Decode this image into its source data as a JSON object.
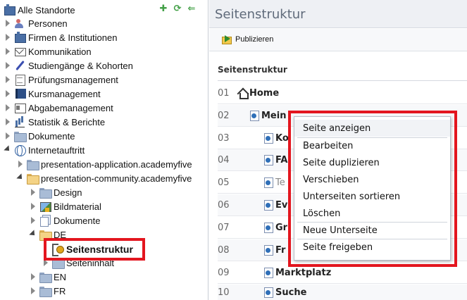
{
  "tree": {
    "root_label": "Alle Standorte",
    "toolbar_icons": [
      "expand-icon",
      "refresh-icon",
      "collapse-icon"
    ],
    "items": [
      {
        "label": "Personen",
        "icon": "people-icon"
      },
      {
        "label": "Firmen & Institutionen",
        "icon": "building-icon"
      },
      {
        "label": "Kommunikation",
        "icon": "mail-icon"
      },
      {
        "label": "Studiengänge & Kohorten",
        "icon": "pen-icon"
      },
      {
        "label": "Prüfungsmanagement",
        "icon": "document-icon"
      },
      {
        "label": "Kursmanagement",
        "icon": "book-icon"
      },
      {
        "label": "Abgabemanagement",
        "icon": "card-icon"
      },
      {
        "label": "Statistik & Berichte",
        "icon": "chart-icon"
      },
      {
        "label": "Dokumente",
        "icon": "folder-icon"
      },
      {
        "label": "Internetauftritt",
        "icon": "globe-icon"
      },
      {
        "label": "presentation-application.academyfive",
        "icon": "folder-icon"
      },
      {
        "label": "presentation-community.academyfive",
        "icon": "folder-open-icon"
      },
      {
        "label": "Design",
        "icon": "folder-icon"
      },
      {
        "label": "Bildmaterial",
        "icon": "image-icon"
      },
      {
        "label": "Dokumente",
        "icon": "documents-icon"
      },
      {
        "label": "DE",
        "icon": "folder-open-icon"
      },
      {
        "label": "Seitenstruktur",
        "icon": "sitemap-key-icon"
      },
      {
        "label": "Seiteninhalt",
        "icon": "folder-icon"
      },
      {
        "label": "EN",
        "icon": "folder-icon"
      },
      {
        "label": "FR",
        "icon": "folder-icon"
      }
    ]
  },
  "main": {
    "title": "Seitenstruktur",
    "publish_label": "Publizieren",
    "grid_header": "Seitenstruktur",
    "rows": [
      {
        "num": "01",
        "label": "Home"
      },
      {
        "num": "02",
        "label": "Mein"
      },
      {
        "num": "03",
        "label": "Ko"
      },
      {
        "num": "04",
        "label": "FA"
      },
      {
        "num": "05",
        "label": "Te"
      },
      {
        "num": "06",
        "label": "Ev"
      },
      {
        "num": "07",
        "label": "Gr"
      },
      {
        "num": "08",
        "label": "Fr"
      },
      {
        "num": "09",
        "label": "Marktplatz"
      },
      {
        "num": "10",
        "label": "Suche"
      }
    ]
  },
  "context_menu": {
    "items": [
      "Seite anzeigen",
      "Bearbeiten",
      "Seite duplizieren",
      "Verschieben",
      "Unterseiten sortieren",
      "Löschen",
      "Neue Unterseite",
      "Seite freigeben"
    ]
  },
  "colors": {
    "highlight_red": "#e3161f",
    "header_bg": "#eef0f4",
    "title_text": "#5f6a7a"
  }
}
